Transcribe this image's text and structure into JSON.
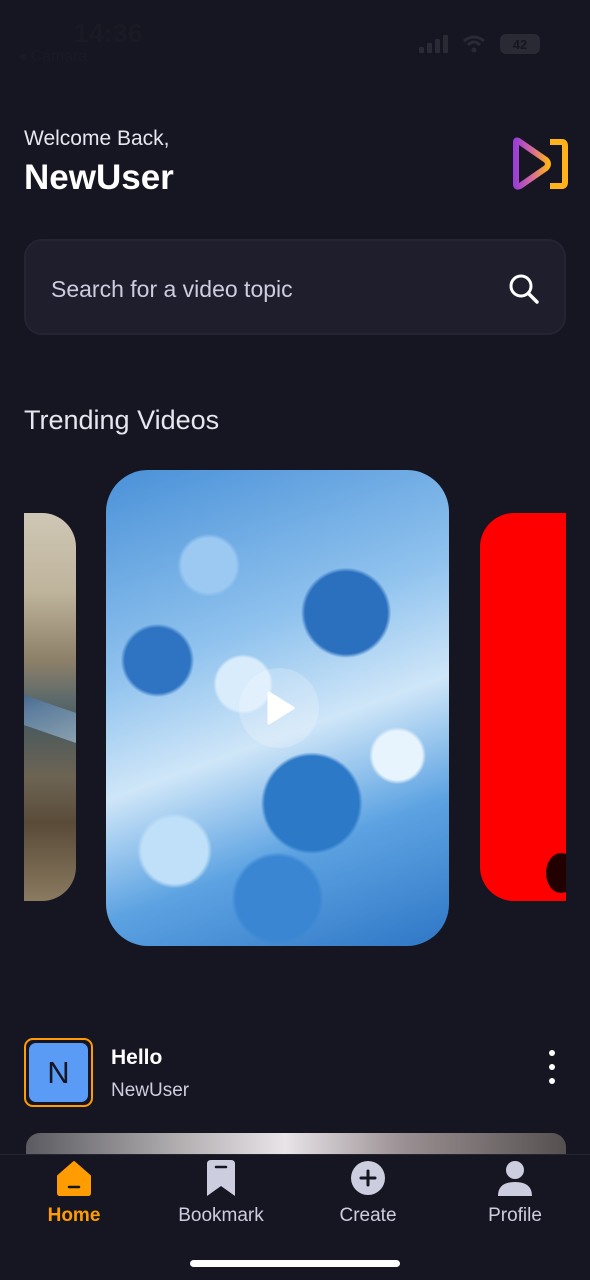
{
  "status_bar": {
    "time": "14:36",
    "back_label": "◂ Cámara",
    "battery": "42"
  },
  "header": {
    "welcome": "Welcome Back,",
    "username": "NewUser",
    "logo_icon": "play-logo-icon"
  },
  "search": {
    "placeholder": "Search for a video topic",
    "icon": "search-icon"
  },
  "trending": {
    "title": "Trending Videos",
    "play_icon": "play-icon"
  },
  "post": {
    "avatar_letter": "N",
    "title": "Hello",
    "author": "NewUser",
    "menu_icon": "more-vertical-icon"
  },
  "tabs": [
    {
      "label": "Home",
      "icon": "home-icon",
      "active": true
    },
    {
      "label": "Bookmark",
      "icon": "bookmark-icon",
      "active": false
    },
    {
      "label": "Create",
      "icon": "plus-circle-icon",
      "active": false
    },
    {
      "label": "Profile",
      "icon": "profile-icon",
      "active": false
    }
  ],
  "colors": {
    "background": "#161622",
    "accent": "#ff9c01",
    "search_bg": "#1e1e2d",
    "avatar_bg": "#5a9bf5",
    "muted_text": "#cdcde0"
  }
}
